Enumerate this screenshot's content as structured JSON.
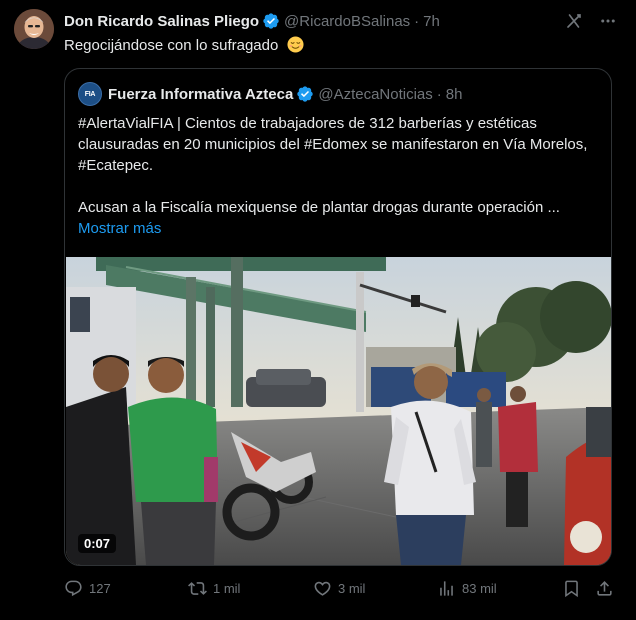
{
  "author": {
    "display_name": "Don Ricardo Salinas Pliego",
    "handle": "@RicardoBSalinas",
    "separator": "·",
    "time": "7h"
  },
  "tweet": {
    "text": "Regocijándose con lo sufragado",
    "emoji_icon": "relieved-face-emoji"
  },
  "quote": {
    "avatar_label": "FIA",
    "display_name": "Fuerza Informativa Azteca",
    "handle": "@AztecaNoticias",
    "separator": "·",
    "time": "8h",
    "paragraph1": "#AlertaVialFIA | Cientos de trabajadores de 312 barberías y estéticas clausuradas en 20 municipios del #Edomex se manifestaron en Vía Morelos, #Ecatepec.",
    "paragraph2": "Acusan a la Fiscalía mexiquense de plantar drogas durante operación ...",
    "show_more": "Mostrar más",
    "video_duration": "0:07"
  },
  "actions": {
    "replies": "127",
    "reposts": "1 mil",
    "likes": "3 mil",
    "views": "83 mil"
  },
  "colors": {
    "background": "#000000",
    "text": "#e7e9ea",
    "muted": "#71767b",
    "accent": "#1d9bf0",
    "border": "#2f3336"
  }
}
